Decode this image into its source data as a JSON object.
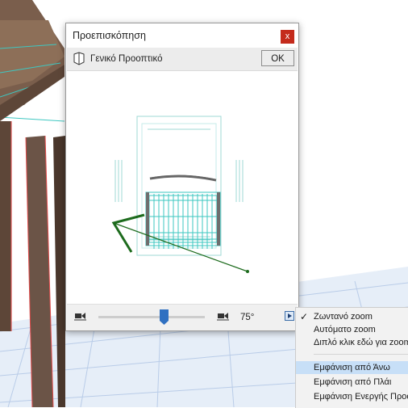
{
  "dialog": {
    "title": "Προεπισκόπηση",
    "close_label": "x",
    "view_name": "Γενικό Προοπτικό",
    "ok_label": "OK",
    "angle_value": "75°",
    "slider_level_fraction": 0.62
  },
  "menu": {
    "items": [
      {
        "label": "Ζωντανό zoom",
        "checked": true
      },
      {
        "label": "Αυτόματο zoom",
        "checked": false
      },
      {
        "label": "Διπλό κλικ εδώ για zoom",
        "checked": false
      },
      {
        "label": "Εμφάνιση από Άνω",
        "selected": true
      },
      {
        "label": "Εμφάνιση από Πλάι",
        "selected": false
      },
      {
        "label": "Εμφάνιση Ενεργής Προοπτικής",
        "selected": false
      }
    ]
  },
  "colors": {
    "accent": "#c42b1c",
    "selection": "#c7dff7",
    "camera_line": "#1d6b1d",
    "structure_cyan": "#3ec7c1",
    "wood": "#6b5447"
  },
  "icons": {
    "view": "view-shield-icon",
    "camera": "camera-icon",
    "menu": "triangle-right-icon",
    "check": "check-icon"
  }
}
